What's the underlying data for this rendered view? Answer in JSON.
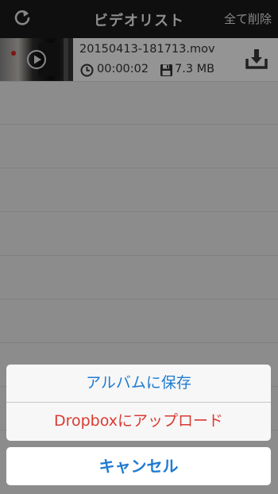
{
  "navbar": {
    "refresh_icon": "refresh-icon",
    "title": "ビデオリスト",
    "delete_all_label": "全て削除"
  },
  "videos": [
    {
      "file_name": "20150413-181713.mov",
      "duration": "00:00:02",
      "size": "7.3 MB",
      "icons": [
        "play-icon",
        "clock-icon",
        "disk-icon",
        "download-icon"
      ]
    }
  ],
  "action_sheet": {
    "save_to_album_label": "アルバムに保存",
    "upload_dropbox_label": "Dropboxにアップロード",
    "cancel_label": "キャンセル"
  },
  "colors": {
    "navbar_bg": "#1a1a1a",
    "action_blue": "#1f7bd1",
    "action_red": "#d93a32",
    "overlay": "rgba(0,0,0,0.42)"
  }
}
